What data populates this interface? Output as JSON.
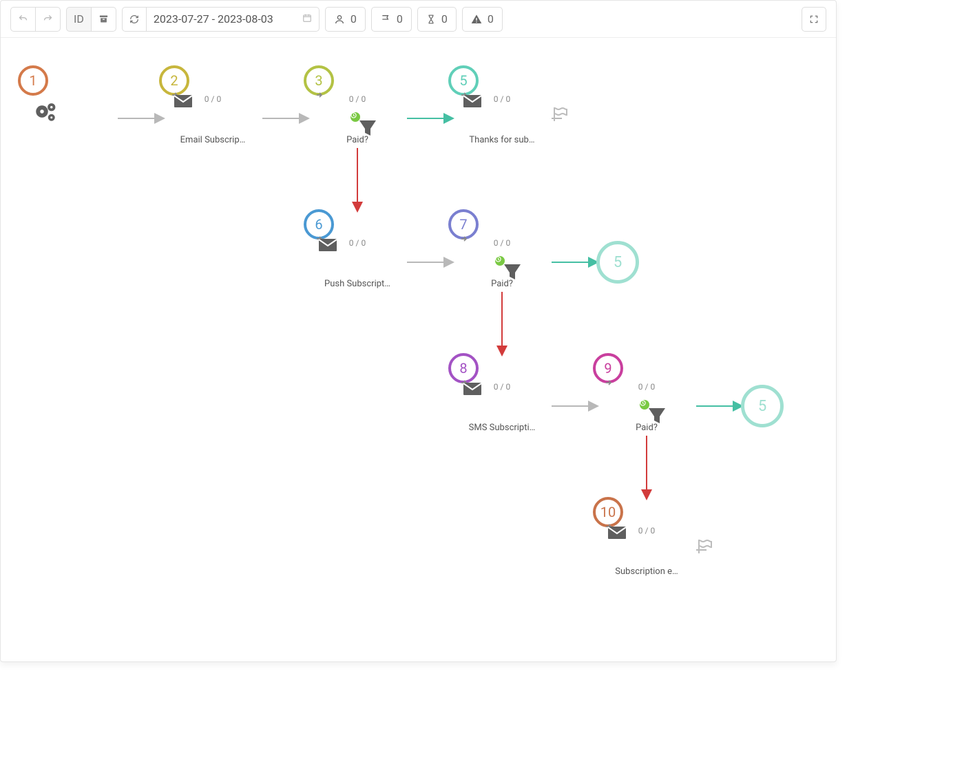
{
  "toolbar": {
    "id_label": "ID",
    "date_range": "2023-07-27 - 2023-08-03",
    "stat_users": "0",
    "stat_goals": "0",
    "stat_waiting": "0",
    "stat_errors": "0"
  },
  "flow_label": "0 / 0",
  "nodes": {
    "n1": {
      "num": "1"
    },
    "n2": {
      "num": "2",
      "flow": "0 / 0",
      "title": "Email Subscrip…"
    },
    "n3": {
      "num": "3",
      "flow": "0 / 0",
      "title": "Paid?"
    },
    "n5a": {
      "num": "5",
      "flow": "0 / 0",
      "title": "Thanks for sub…"
    },
    "n6": {
      "num": "6",
      "flow": "0 / 0",
      "title": "Push Subscript…"
    },
    "n7": {
      "num": "7",
      "flow": "0 / 0",
      "title": "Paid?"
    },
    "n5b": {
      "num": "5"
    },
    "n8": {
      "num": "8",
      "flow": "0 / 0",
      "title": "SMS Subscripti…"
    },
    "n9": {
      "num": "9",
      "flow": "0 / 0",
      "title": "Paid?"
    },
    "n5c": {
      "num": "5"
    },
    "n10": {
      "num": "10",
      "flow": "0 / 0",
      "title": "Subscription e…"
    }
  },
  "colors": {
    "n1": "#d47a4a",
    "n2": "#c7b63c",
    "n3": "#b3c244",
    "n5": "#60cfb8",
    "n5ref": "#9fe0d1",
    "n6": "#4a99d3",
    "n7": "#7a7fd0",
    "n8": "#a352c4",
    "n9": "#c93f9e",
    "n10": "#c9734a"
  }
}
